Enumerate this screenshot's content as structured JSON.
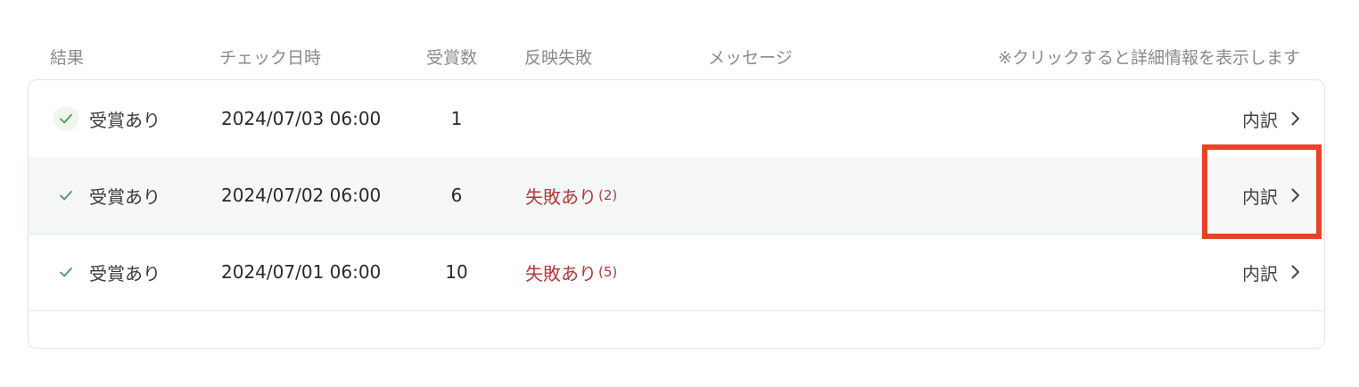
{
  "header": {
    "result": "結果",
    "date": "チェック日時",
    "count": "受賞数",
    "fail": "反映失敗",
    "message": "メッセージ",
    "note": "※クリックすると詳細情報を表示します"
  },
  "rows": [
    {
      "status": "受賞あり",
      "date": "2024/07/03 06:00",
      "count": "1",
      "fail_label": "",
      "fail_count": "",
      "detail": "内訳"
    },
    {
      "status": "受賞あり",
      "date": "2024/07/02 06:00",
      "count": "6",
      "fail_label": "失敗あり",
      "fail_count": "(2)",
      "detail": "内訳"
    },
    {
      "status": "受賞あり",
      "date": "2024/07/01 06:00",
      "count": "10",
      "fail_label": "失敗あり",
      "fail_count": "(5)",
      "detail": "内訳"
    }
  ],
  "icons": {
    "status": "check-icon",
    "detail": "chevron-right-icon"
  },
  "colors": {
    "check": "#4a9a5a",
    "fail": "#b23a3a",
    "highlight": "#e8432a",
    "alt_row": "#f6f8f8"
  }
}
